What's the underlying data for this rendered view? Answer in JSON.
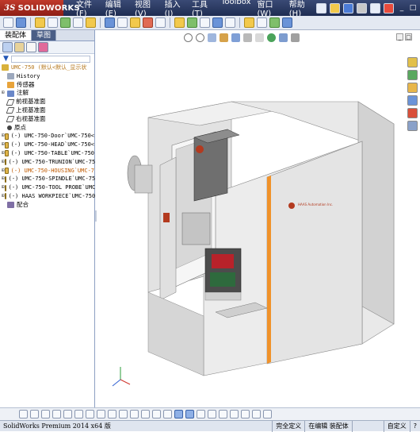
{
  "app": {
    "logo_text": "SOLIDWORKS",
    "logo_prefix": "3S"
  },
  "menu": [
    "文件(F)",
    "编辑(E)",
    "视图(V)",
    "插入(I)",
    "工具(T)",
    "Toolbox",
    "窗口(W)",
    "帮助(H)"
  ],
  "panel": {
    "tabs": [
      "装配体",
      "草图"
    ],
    "filter_icon": "filter-icon"
  },
  "tree": {
    "root": "UMC-750 (默认<默认_显示状",
    "items": [
      {
        "label": "History",
        "icon": "history"
      },
      {
        "label": "传感器",
        "icon": "sensor"
      },
      {
        "label": "注解",
        "icon": "annotation"
      },
      {
        "label": "前视基准面",
        "icon": "plane"
      },
      {
        "label": "上视基准面",
        "icon": "plane"
      },
      {
        "label": "右视基准面",
        "icon": "plane"
      },
      {
        "label": "原点",
        "icon": "origin"
      },
      {
        "label": "(-) UMC-750-Door`UMC-750<",
        "icon": "part"
      },
      {
        "label": "(-) UMC-750-HEAD`UMC-750<",
        "icon": "part"
      },
      {
        "label": "(-) UMC-750-TABLE`UMC-750",
        "icon": "part"
      },
      {
        "label": "(-) UMC-750-TRUNION`UMC-75",
        "icon": "part"
      },
      {
        "label": "(-) UMC-750-HOUSING`UMC-7",
        "icon": "part-warning"
      },
      {
        "label": "(-) UMC-750-SPINDLE`UMC-75",
        "icon": "part"
      },
      {
        "label": "(-) UMC-750-TOOL PROBE`UMC",
        "icon": "part"
      },
      {
        "label": "(-) HAAS WORKPIECE`UMC-750",
        "icon": "part"
      },
      {
        "label": "配合",
        "icon": "mate"
      }
    ]
  },
  "model": {
    "brand_text": "HAAS Automation Inc.",
    "brand_color": "#b33a1f",
    "body_color": "#dcdcdc",
    "accent_color": "#f0922a"
  },
  "status": {
    "app_name": "SolidWorks Premium 2014 x64 版",
    "fully_defined": "完全定义",
    "editing": "在编辑 装配体",
    "custom": "自定义"
  },
  "colors": {
    "menubar": "#1f2d52",
    "logo": "#c0392b",
    "panel_border": "#8da0c3"
  }
}
